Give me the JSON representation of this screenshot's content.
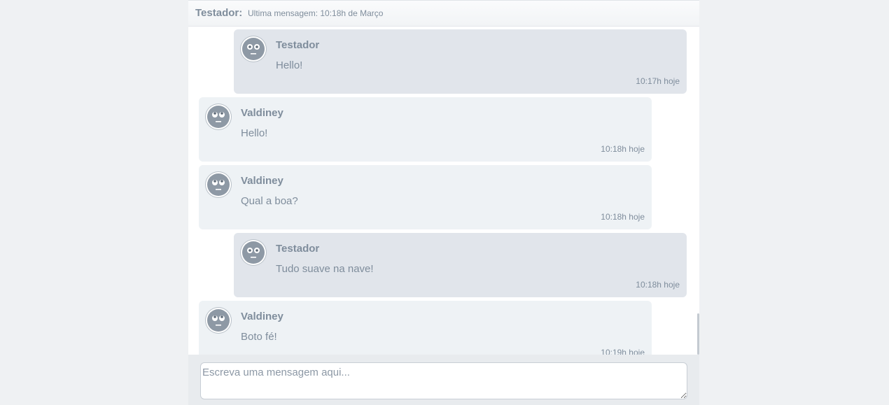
{
  "header": {
    "contact_name": "Testador:",
    "status": "Ultima mensagem: 10:18h de Março"
  },
  "messages": [
    {
      "sender": "Testador",
      "text": "Hello!",
      "time": "10:17h hoje",
      "side": "self",
      "avatar": "neutral-face-icon"
    },
    {
      "sender": "Valdiney",
      "text": "Hello!",
      "time": "10:18h hoje",
      "side": "other",
      "avatar": "eye-roll-face-icon"
    },
    {
      "sender": "Valdiney",
      "text": "Qual a boa?",
      "time": "10:18h hoje",
      "side": "other",
      "avatar": "eye-roll-face-icon"
    },
    {
      "sender": "Testador",
      "text": "Tudo suave na nave!",
      "time": "10:18h hoje",
      "side": "self",
      "avatar": "neutral-face-icon"
    },
    {
      "sender": "Valdiney",
      "text": "Boto fé!",
      "time": "10:19h hoje",
      "side": "other",
      "avatar": "eye-roll-face-icon"
    }
  ],
  "composer": {
    "placeholder": "Escreva uma mensagem aqui...",
    "value": ""
  },
  "colors": {
    "page_background": "#eff1f3",
    "self_bubble": "#e1e5eb",
    "other_bubble": "#eef2f5",
    "text": "#7f8d9c",
    "avatar_face": "#8e99a5"
  }
}
